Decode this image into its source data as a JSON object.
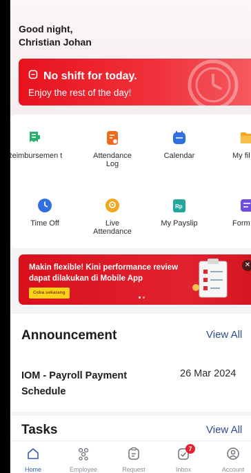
{
  "greeting": {
    "line1": "Good night,",
    "line2": "Christian Johan"
  },
  "shift": {
    "title": "No shift for today.",
    "subtitle": "Enjoy the rest of the day!"
  },
  "menu": [
    {
      "label": "Reimbursemen t",
      "icon": "receipt-icon",
      "color": "#27b06e"
    },
    {
      "label": "Attendance Log",
      "icon": "attendance-log-icon",
      "color": "#f06a1d"
    },
    {
      "label": "Calendar",
      "icon": "calendar-icon",
      "color": "#2f6fe0"
    },
    {
      "label": "My fil",
      "icon": "folder-icon",
      "color": "#f2a81d"
    },
    {
      "label": "Time Off",
      "icon": "clock-icon",
      "color": "#2f6fe0"
    },
    {
      "label": "Live Attendance",
      "icon": "location-pin-icon",
      "color": "#f2a81d"
    },
    {
      "label": "My Payslip",
      "icon": "payslip-icon",
      "color": "#22a79c"
    },
    {
      "label": "Form",
      "icon": "form-icon",
      "color": "#6d4ce0"
    }
  ],
  "banner": {
    "text": "Makin flexible! Kini performance review dapat dilakukan di Mobile App",
    "cta": "Coba sekarang",
    "close": "✕"
  },
  "announcement": {
    "title": "Announcement",
    "view_all": "View All",
    "item_title": "IOM - Payroll Payment Schedule",
    "item_date": "26 Mar 2024"
  },
  "tasks": {
    "title": "Tasks",
    "view_all": "View All"
  },
  "nav": [
    {
      "label": "Home",
      "icon": "home-icon",
      "active": true
    },
    {
      "label": "Employee",
      "icon": "employee-icon",
      "active": false
    },
    {
      "label": "Request",
      "icon": "request-icon",
      "active": false
    },
    {
      "label": "Inbox",
      "icon": "inbox-icon",
      "active": false,
      "badge": "7"
    },
    {
      "label": "Account",
      "icon": "account-icon",
      "active": false
    }
  ],
  "colors": {
    "primary_red": "#e8121e",
    "link_blue": "#2e4a8f",
    "nav_active": "#2e5bb8"
  }
}
